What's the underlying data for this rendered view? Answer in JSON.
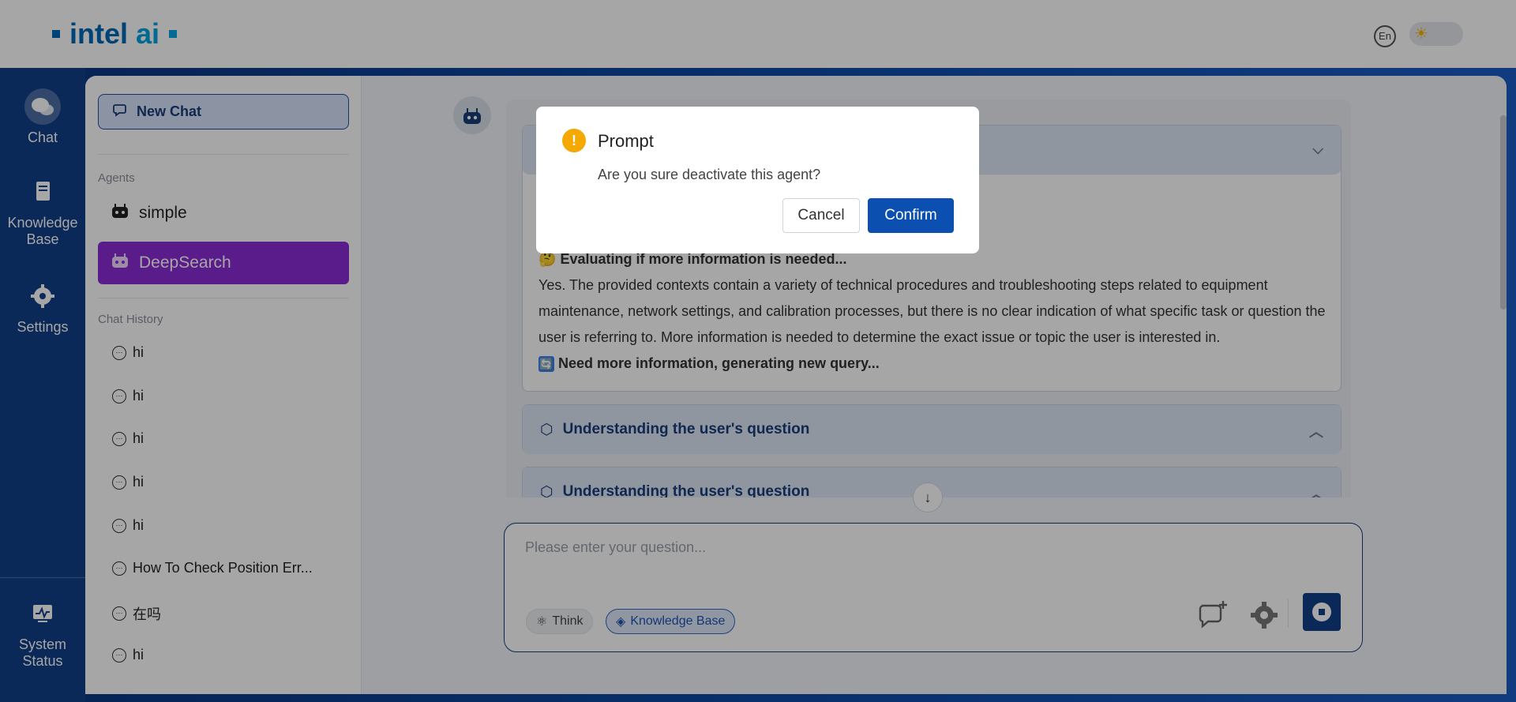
{
  "header": {
    "brand_main": "intel",
    "brand_ai": "ai",
    "lang_label": "En"
  },
  "nav": {
    "items": [
      {
        "label": "Chat",
        "icon": "chat-icon"
      },
      {
        "label": "Knowledge Base",
        "icon": "knowledge-base-icon"
      },
      {
        "label": "Settings",
        "icon": "gear-icon"
      },
      {
        "label": "System Status",
        "icon": "monitor-icon"
      }
    ]
  },
  "sidebar": {
    "new_chat": "New Chat",
    "agents_label": "Agents",
    "agents": [
      "simple",
      "DeepSearch"
    ],
    "history_label": "Chat History",
    "history": [
      "hi",
      "hi",
      "hi",
      "hi",
      "hi",
      "How To Check Position Err...",
      "在吗",
      "hi"
    ]
  },
  "chat": {
    "eval_heading": "Evaluating if more information is needed...",
    "eval_text": "Yes. The provided contexts contain a variety of technical procedures and troubleshooting steps related to equipment maintenance, network settings, and calibration processes, but there is no clear indication of what specific task or question the user is referring to. More information is needed to determine the exact issue or topic the user is interested in.",
    "need_more": "Need more information, generating new query...",
    "step1": "Understanding the user's question",
    "step2": "Understanding the user's question"
  },
  "input": {
    "placeholder": "Please enter your question...",
    "think_chip": "Think",
    "kb_chip": "Knowledge Base"
  },
  "dialog": {
    "title": "Prompt",
    "message": "Are you sure deactivate this agent?",
    "cancel": "Cancel",
    "confirm": "Confirm"
  },
  "colors": {
    "brand": "#0068b5",
    "nav_bg": "#103e88",
    "agent_active": "#8a2bd6",
    "confirm": "#0b4fb0",
    "warning": "#f5a800"
  }
}
